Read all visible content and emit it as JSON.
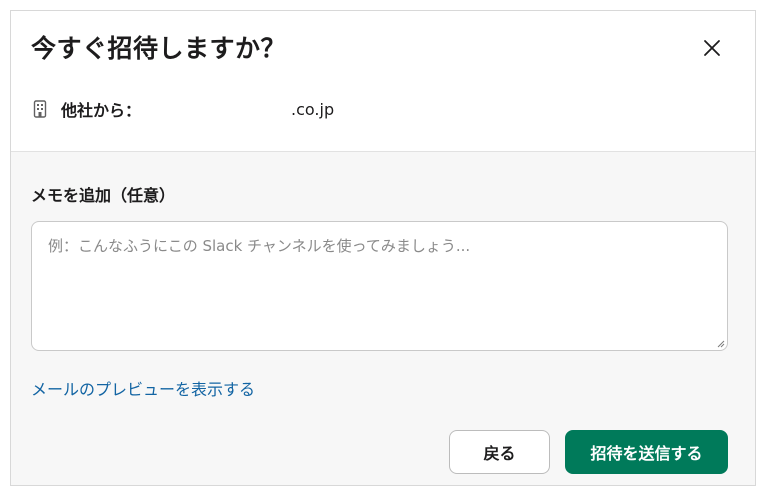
{
  "dialog": {
    "title": "今すぐ招待しますか？",
    "close_icon": "close-icon",
    "org": {
      "icon": "building-icon",
      "label": "他社から：",
      "domain": ".co.jp"
    }
  },
  "memo": {
    "label": "メモを追加（任意）",
    "placeholder": "例：こんなふうにこの Slack チャンネルを使ってみましょう...",
    "value": ""
  },
  "preview_link": "メールのプレビューを表示する",
  "buttons": {
    "back_label": "戻る",
    "send_label": "招待を送信する"
  },
  "colors": {
    "primary": "#007a5a",
    "link": "#1264a3",
    "text": "#1d1c1d",
    "body_bg": "#f7f7f7"
  }
}
